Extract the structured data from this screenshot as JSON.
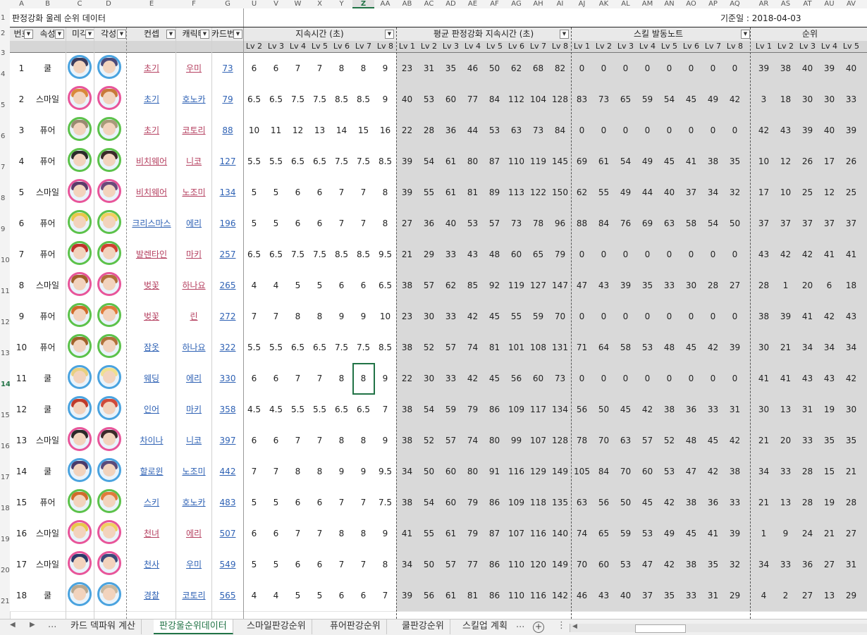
{
  "app": {
    "title": "판정강화 울레 순위 데이터",
    "reference_date": "기준일 : 2018-04-03"
  },
  "columns": [
    "A",
    "B",
    "C",
    "D",
    "E",
    "F",
    "G",
    "U",
    "V",
    "W",
    "X",
    "Y",
    "Z",
    "AA",
    "AB",
    "AC",
    "AD",
    "AE",
    "AF",
    "AG",
    "AH",
    "AI",
    "AJ",
    "AK",
    "AL",
    "AM",
    "AN",
    "AO",
    "AP",
    "AQ",
    "AR",
    "AS",
    "AT",
    "AU",
    "AV"
  ],
  "active_column": "Z",
  "row_numbers": [
    "1",
    "2",
    "3",
    "4",
    "5",
    "6",
    "7",
    "8",
    "9",
    "10",
    "11",
    "12",
    "13",
    "14",
    "15",
    "16",
    "17",
    "18",
    "19",
    "20",
    "21"
  ],
  "active_row": "14",
  "headers": {
    "number": "번호",
    "attribute": "속성",
    "unawakened": "미각",
    "awakened": "각성",
    "concept": "컨셉",
    "character": "캐릭터",
    "card_number": "카드번호",
    "duration": "지속시간 (초)",
    "avg_duration": "평균 판정강화 지속시간 (초)",
    "skill_notes": "스킬 발동노트",
    "rank": "순위"
  },
  "levels": [
    "Lv 2",
    "Lv 3",
    "Lv 4",
    "Lv 5",
    "Lv 6",
    "Lv 7",
    "Lv 8"
  ],
  "levels_full": [
    "Lv 1",
    "Lv 2",
    "Lv 3",
    "Lv 4",
    "Lv 5",
    "Lv 6",
    "Lv 7",
    "Lv 8"
  ],
  "levels_rank": [
    "Lv 1",
    "Lv 2",
    "Lv 3",
    "Lv 4",
    "Lv 5"
  ],
  "attribute_colors": {
    "쿨": "#4aa3df",
    "스마일": "#e8559a",
    "퓨어": "#5cc24a"
  },
  "rows": [
    {
      "n": "1",
      "attr": "쿨",
      "concept": "초기",
      "concept_color": "red",
      "char": "우미",
      "card": "73",
      "dur": [
        "6",
        "6",
        "7",
        "7",
        "8",
        "8",
        "9"
      ],
      "avg": [
        "23",
        "31",
        "35",
        "46",
        "50",
        "62",
        "68",
        "82"
      ],
      "notes": [
        "0",
        "0",
        "0",
        "0",
        "0",
        "0",
        "0",
        "0"
      ],
      "rank": [
        "39",
        "38",
        "40",
        "39",
        "40"
      ]
    },
    {
      "n": "2",
      "attr": "스마일",
      "concept": "초기",
      "concept_color": "blue",
      "char": "호노카",
      "card": "79",
      "dur": [
        "6.5",
        "6.5",
        "7.5",
        "7.5",
        "8.5",
        "8.5",
        "9"
      ],
      "avg": [
        "40",
        "53",
        "60",
        "77",
        "84",
        "112",
        "104",
        "128"
      ],
      "notes": [
        "83",
        "73",
        "65",
        "59",
        "54",
        "45",
        "49",
        "42"
      ],
      "rank": [
        "3",
        "18",
        "30",
        "30",
        "33"
      ]
    },
    {
      "n": "3",
      "attr": "퓨어",
      "concept": "초기",
      "concept_color": "red",
      "char": "코토리",
      "card": "88",
      "dur": [
        "10",
        "11",
        "12",
        "13",
        "14",
        "15",
        "16"
      ],
      "avg": [
        "22",
        "28",
        "36",
        "44",
        "53",
        "63",
        "73",
        "84"
      ],
      "notes": [
        "0",
        "0",
        "0",
        "0",
        "0",
        "0",
        "0",
        "0"
      ],
      "rank": [
        "42",
        "43",
        "39",
        "40",
        "39"
      ]
    },
    {
      "n": "4",
      "attr": "퓨어",
      "concept": "비치웨어",
      "concept_color": "red",
      "char": "니코",
      "card": "127",
      "dur": [
        "5.5",
        "5.5",
        "6.5",
        "6.5",
        "7.5",
        "7.5",
        "8.5"
      ],
      "avg": [
        "39",
        "54",
        "61",
        "80",
        "87",
        "110",
        "119",
        "145"
      ],
      "notes": [
        "69",
        "61",
        "54",
        "49",
        "45",
        "41",
        "38",
        "35"
      ],
      "rank": [
        "10",
        "12",
        "26",
        "17",
        "26"
      ]
    },
    {
      "n": "5",
      "attr": "스마일",
      "concept": "비치웨어",
      "concept_color": "red",
      "char": "노조미",
      "card": "134",
      "dur": [
        "5",
        "5",
        "6",
        "6",
        "7",
        "7",
        "8"
      ],
      "avg": [
        "39",
        "55",
        "61",
        "81",
        "89",
        "113",
        "122",
        "150"
      ],
      "notes": [
        "62",
        "55",
        "49",
        "44",
        "40",
        "37",
        "34",
        "32"
      ],
      "rank": [
        "17",
        "10",
        "25",
        "12",
        "25"
      ]
    },
    {
      "n": "6",
      "attr": "퓨어",
      "concept": "크리스마스",
      "concept_color": "blue",
      "char": "에리",
      "card": "196",
      "dur": [
        "5",
        "5",
        "6",
        "6",
        "7",
        "7",
        "8"
      ],
      "avg": [
        "27",
        "36",
        "40",
        "53",
        "57",
        "73",
        "78",
        "96"
      ],
      "notes": [
        "88",
        "84",
        "76",
        "69",
        "63",
        "58",
        "54",
        "50"
      ],
      "rank": [
        "37",
        "37",
        "37",
        "37",
        "37"
      ]
    },
    {
      "n": "7",
      "attr": "퓨어",
      "concept": "발렌타인",
      "concept_color": "red",
      "char": "마키",
      "card": "257",
      "dur": [
        "6.5",
        "6.5",
        "7.5",
        "7.5",
        "8.5",
        "8.5",
        "9.5"
      ],
      "avg": [
        "21",
        "29",
        "33",
        "43",
        "48",
        "60",
        "65",
        "79"
      ],
      "notes": [
        "0",
        "0",
        "0",
        "0",
        "0",
        "0",
        "0",
        "0"
      ],
      "rank": [
        "43",
        "42",
        "42",
        "41",
        "41"
      ]
    },
    {
      "n": "8",
      "attr": "스마일",
      "concept": "벚꽃",
      "concept_color": "red",
      "char": "하나요",
      "card": "265",
      "dur": [
        "4",
        "4",
        "5",
        "5",
        "6",
        "6",
        "6.5"
      ],
      "avg": [
        "38",
        "57",
        "62",
        "85",
        "92",
        "119",
        "127",
        "147"
      ],
      "notes": [
        "47",
        "43",
        "39",
        "35",
        "33",
        "30",
        "28",
        "27"
      ],
      "rank": [
        "28",
        "1",
        "20",
        "6",
        "18"
      ]
    },
    {
      "n": "9",
      "attr": "퓨어",
      "concept": "벚꽃",
      "concept_color": "red",
      "char": "린",
      "card": "272",
      "dur": [
        "7",
        "7",
        "8",
        "8",
        "9",
        "9",
        "10"
      ],
      "avg": [
        "23",
        "30",
        "33",
        "42",
        "45",
        "55",
        "59",
        "70"
      ],
      "notes": [
        "0",
        "0",
        "0",
        "0",
        "0",
        "0",
        "0",
        "0"
      ],
      "rank": [
        "38",
        "39",
        "41",
        "42",
        "43"
      ]
    },
    {
      "n": "10",
      "attr": "퓨어",
      "concept": "잠옷",
      "concept_color": "blue",
      "char": "하나요",
      "card": "322",
      "dur": [
        "5.5",
        "5.5",
        "6.5",
        "6.5",
        "7.5",
        "7.5",
        "8.5"
      ],
      "avg": [
        "38",
        "52",
        "57",
        "74",
        "81",
        "101",
        "108",
        "131"
      ],
      "notes": [
        "71",
        "64",
        "58",
        "53",
        "48",
        "45",
        "42",
        "39"
      ],
      "rank": [
        "30",
        "21",
        "34",
        "34",
        "34"
      ]
    },
    {
      "n": "11",
      "attr": "쿨",
      "concept": "웨딩",
      "concept_color": "blue",
      "char": "에리",
      "card": "330",
      "dur": [
        "6",
        "6",
        "7",
        "7",
        "8",
        "8",
        "9"
      ],
      "avg": [
        "22",
        "30",
        "33",
        "42",
        "45",
        "56",
        "60",
        "73"
      ],
      "notes": [
        "0",
        "0",
        "0",
        "0",
        "0",
        "0",
        "0",
        "0"
      ],
      "rank": [
        "41",
        "41",
        "43",
        "43",
        "42"
      ]
    },
    {
      "n": "12",
      "attr": "쿨",
      "concept": "인어",
      "concept_color": "blue",
      "char": "마키",
      "card": "358",
      "dur": [
        "4.5",
        "4.5",
        "5.5",
        "5.5",
        "6.5",
        "6.5",
        "7"
      ],
      "avg": [
        "38",
        "54",
        "59",
        "79",
        "86",
        "109",
        "117",
        "134"
      ],
      "notes": [
        "56",
        "50",
        "45",
        "42",
        "38",
        "36",
        "33",
        "31"
      ],
      "rank": [
        "30",
        "13",
        "31",
        "19",
        "30"
      ]
    },
    {
      "n": "13",
      "attr": "스마일",
      "concept": "차이나",
      "concept_color": "blue",
      "char": "니코",
      "card": "397",
      "dur": [
        "6",
        "6",
        "7",
        "7",
        "8",
        "8",
        "9"
      ],
      "avg": [
        "38",
        "52",
        "57",
        "74",
        "80",
        "99",
        "107",
        "128"
      ],
      "notes": [
        "78",
        "70",
        "63",
        "57",
        "52",
        "48",
        "45",
        "42"
      ],
      "rank": [
        "21",
        "20",
        "33",
        "35",
        "35"
      ]
    },
    {
      "n": "14",
      "attr": "쿨",
      "concept": "할로윈",
      "concept_color": "blue",
      "char": "노조미",
      "card": "442",
      "dur": [
        "7",
        "7",
        "8",
        "8",
        "9",
        "9",
        "9.5"
      ],
      "avg": [
        "34",
        "50",
        "60",
        "80",
        "91",
        "116",
        "129",
        "149"
      ],
      "notes": [
        "105",
        "84",
        "70",
        "60",
        "53",
        "47",
        "42",
        "38"
      ],
      "rank": [
        "34",
        "33",
        "28",
        "15",
        "21"
      ]
    },
    {
      "n": "15",
      "attr": "퓨어",
      "concept": "스키",
      "concept_color": "blue",
      "char": "호노카",
      "card": "483",
      "dur": [
        "5",
        "5",
        "6",
        "6",
        "7",
        "7",
        "7.5"
      ],
      "avg": [
        "38",
        "54",
        "60",
        "79",
        "86",
        "109",
        "118",
        "135"
      ],
      "notes": [
        "63",
        "56",
        "50",
        "45",
        "42",
        "38",
        "36",
        "33"
      ],
      "rank": [
        "21",
        "13",
        "28",
        "19",
        "28"
      ]
    },
    {
      "n": "16",
      "attr": "스마일",
      "concept": "천녀",
      "concept_color": "red",
      "char": "에리",
      "card": "507",
      "dur": [
        "6",
        "6",
        "7",
        "7",
        "8",
        "8",
        "9"
      ],
      "avg": [
        "41",
        "55",
        "61",
        "79",
        "87",
        "107",
        "116",
        "140"
      ],
      "notes": [
        "74",
        "65",
        "59",
        "53",
        "49",
        "45",
        "41",
        "39"
      ],
      "rank": [
        "1",
        "9",
        "24",
        "21",
        "27"
      ]
    },
    {
      "n": "17",
      "attr": "스마일",
      "concept": "천사",
      "concept_color": "blue",
      "char": "우미",
      "card": "549",
      "dur": [
        "5",
        "5",
        "6",
        "6",
        "7",
        "7",
        "8"
      ],
      "avg": [
        "34",
        "50",
        "57",
        "77",
        "86",
        "110",
        "120",
        "149"
      ],
      "notes": [
        "70",
        "60",
        "53",
        "47",
        "42",
        "38",
        "35",
        "32"
      ],
      "rank": [
        "34",
        "33",
        "36",
        "27",
        "31"
      ]
    },
    {
      "n": "18",
      "attr": "쿨",
      "concept": "경찰",
      "concept_color": "blue",
      "char": "코토리",
      "card": "565",
      "dur": [
        "4",
        "4",
        "5",
        "5",
        "6",
        "6",
        "7"
      ],
      "avg": [
        "39",
        "56",
        "61",
        "81",
        "86",
        "110",
        "116",
        "142"
      ],
      "notes": [
        "46",
        "43",
        "40",
        "37",
        "35",
        "33",
        "31",
        "29"
      ],
      "rank": [
        "4",
        "2",
        "27",
        "13",
        "29"
      ]
    }
  ],
  "tabs": [
    {
      "label": "카드 덱파워 계산",
      "active": false
    },
    {
      "label": "판강울순위데이터",
      "active": true
    },
    {
      "label": "스마일판강순위",
      "active": false
    },
    {
      "label": "퓨어판강순위",
      "active": false
    },
    {
      "label": "쿨판강순위",
      "active": false
    },
    {
      "label": "스킬업 계획",
      "active": false
    }
  ],
  "tab_nav": {
    "prev": "◀",
    "next": "▶",
    "more": "...",
    "add": "+",
    "menu": "⋮"
  }
}
